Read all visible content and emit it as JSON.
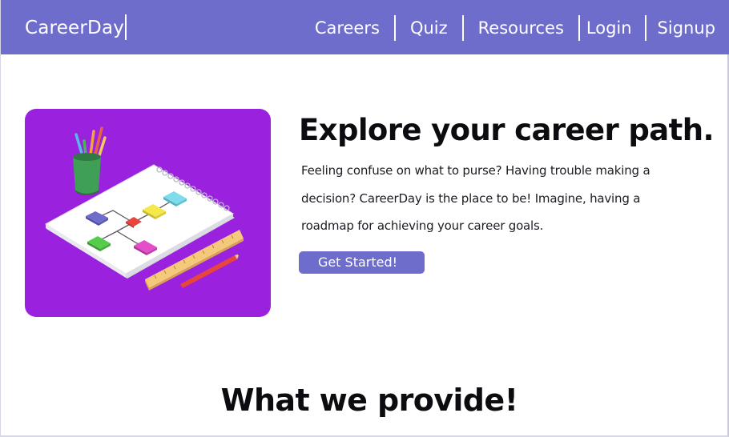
{
  "brand": {
    "name": "CareerDay"
  },
  "nav": {
    "links": [
      "Careers",
      "Quiz",
      "Resources",
      "Login",
      "Signup"
    ]
  },
  "hero": {
    "title": "Explore your career path.",
    "description": "Feeling confuse on what to purse? Having trouble making a decision? CareerDay is the place to be! Imagine,  having a roadmap for achieving your career goals.",
    "cta_label": "Get Started!"
  },
  "section": {
    "title": "What we provide!"
  },
  "colors": {
    "nav_background": "#6e6dcc",
    "illustration_background": "#9a22de",
    "cta_background": "#6e6dcc"
  }
}
